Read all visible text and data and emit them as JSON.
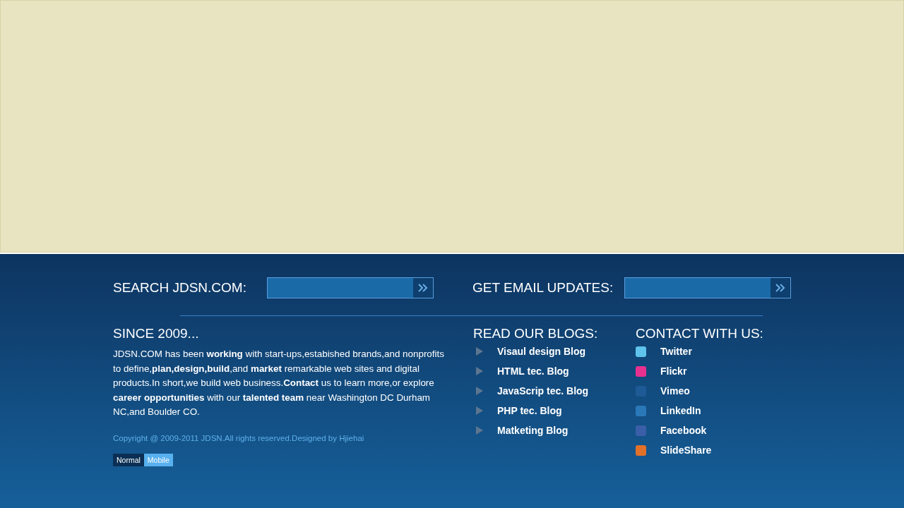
{
  "search": {
    "label": "SEARCH JDSN.COM:"
  },
  "email": {
    "label": "GET EMAIL UPDATES:"
  },
  "about": {
    "title": "SINCE 2009...",
    "text": "JDSN.COM has been **working** with start-ups,estabished brands,and nonprofits to define,**plan,design,build**,and **market** remarkable web sites and digital products.In short,we build web business.**Contact** us to  learn more,or explore **career opportunities** with our **talented team** near Washington DC Durham NC,and Boulder CO.",
    "copyright": "Copyright @ 2009-2011 JDSN.All rights reserved.Designed by Hjiehai",
    "views": [
      {
        "label": "Normal",
        "selected": false
      },
      {
        "label": "Mobile",
        "selected": true
      }
    ]
  },
  "blogs": {
    "title": "READ OUR BLOGS:",
    "items": [
      "Visaul design Blog",
      "HTML tec. Blog",
      "JavaScrip tec. Blog",
      "PHP tec. Blog",
      "Matketing Blog"
    ]
  },
  "contact": {
    "title": "CONTACT WITH US:",
    "items": [
      {
        "label": "Twitter",
        "color": "#5fc3ec"
      },
      {
        "label": "Flickr",
        "color": "#e8308f"
      },
      {
        "label": "Vimeo",
        "color": "#1d5a96"
      },
      {
        "label": "LinkedIn",
        "color": "#2a78b8"
      },
      {
        "label": "Facebook",
        "color": "#3b5ea8"
      },
      {
        "label": "SlideShare",
        "color": "#e0702a"
      }
    ]
  }
}
